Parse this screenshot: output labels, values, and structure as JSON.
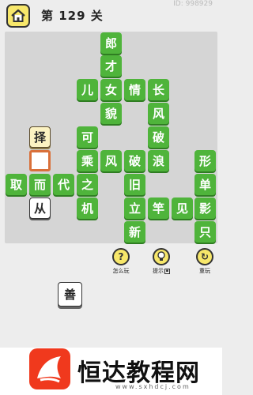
{
  "header": {
    "level_label": "第 129 关",
    "id_label": "ID: 998929"
  },
  "board": {
    "tiles": [
      {
        "char": "郎",
        "style": "green"
      },
      {
        "char": "才",
        "style": "green"
      },
      {
        "char": "儿",
        "style": "green"
      },
      {
        "char": "女",
        "style": "green"
      },
      {
        "char": "情",
        "style": "green"
      },
      {
        "char": "长",
        "style": "green"
      },
      {
        "char": "貌",
        "style": "green"
      },
      {
        "char": "风",
        "style": "green"
      },
      {
        "char": "择",
        "style": "cream"
      },
      {
        "char": "可",
        "style": "green"
      },
      {
        "char": "破",
        "style": "green"
      },
      {
        "char": "",
        "style": "slot"
      },
      {
        "char": "乘",
        "style": "green"
      },
      {
        "char": "风",
        "style": "green"
      },
      {
        "char": "破",
        "style": "green"
      },
      {
        "char": "浪",
        "style": "green"
      },
      {
        "char": "形",
        "style": "green"
      },
      {
        "char": "取",
        "style": "green"
      },
      {
        "char": "而",
        "style": "green"
      },
      {
        "char": "代",
        "style": "green"
      },
      {
        "char": "之",
        "style": "green"
      },
      {
        "char": "旧",
        "style": "green"
      },
      {
        "char": "单",
        "style": "green"
      },
      {
        "char": "从",
        "style": "white"
      },
      {
        "char": "机",
        "style": "green"
      },
      {
        "char": "立",
        "style": "green"
      },
      {
        "char": "竿",
        "style": "green"
      },
      {
        "char": "见",
        "style": "green"
      },
      {
        "char": "影",
        "style": "green"
      },
      {
        "char": "新",
        "style": "green"
      },
      {
        "char": "只",
        "style": "green"
      }
    ]
  },
  "tools": [
    {
      "label": "怎么玩",
      "icon": "question-icon",
      "glyph": "?"
    },
    {
      "label": "提示",
      "icon": "lightbulb-icon",
      "glyph": "💡"
    },
    {
      "label": "重玩",
      "icon": "replay-icon",
      "glyph": "↻"
    }
  ],
  "candidates": [
    "善"
  ],
  "footer": {
    "brand": "恒达教程网",
    "site": "www.sxhdcj.com"
  },
  "colors": {
    "tile_green": "#4fb43b",
    "slot_border": "#d9703a",
    "logo_red": "#f0391d",
    "button_yellow": "#f7e76a"
  }
}
